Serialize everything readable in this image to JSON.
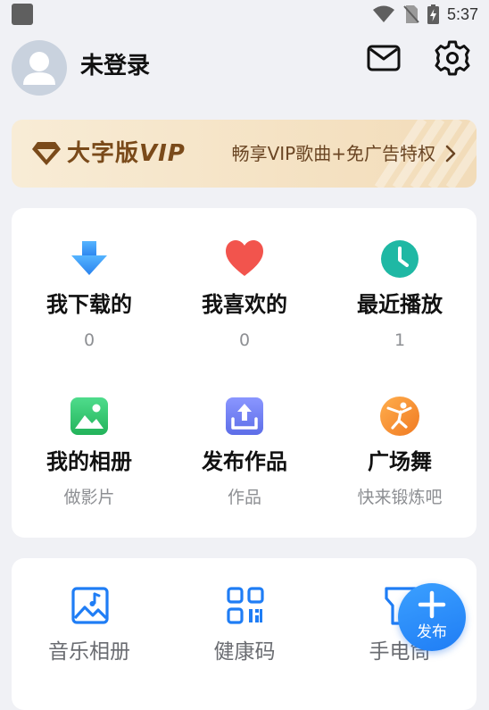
{
  "status_bar": {
    "time": "5:37"
  },
  "header": {
    "login_status": "未登录"
  },
  "vip_banner": {
    "title_cn": "大字版",
    "title_en": "VIP",
    "description": "畅享VIP歌曲+免广告特权"
  },
  "grid": [
    {
      "label": "我下载的",
      "sub": "0",
      "icon": "download-icon",
      "color": "#2f8ff0"
    },
    {
      "label": "我喜欢的",
      "sub": "0",
      "icon": "heart-icon",
      "color": "#f2544d"
    },
    {
      "label": "最近播放",
      "sub": "1",
      "icon": "clock-icon",
      "color": "#1fb8a4"
    },
    {
      "label": "我的相册",
      "sub": "做影片",
      "icon": "photo-album-icon",
      "color": "#35c469"
    },
    {
      "label": "发布作品",
      "sub": "作品",
      "icon": "upload-icon",
      "color": "#6b7cf0"
    },
    {
      "label": "广场舞",
      "sub": "快来锻炼吧",
      "icon": "dancer-icon",
      "color": "#f28a2e"
    }
  ],
  "tools": [
    {
      "label": "音乐相册",
      "icon": "music-album-icon"
    },
    {
      "label": "健康码",
      "icon": "qr-code-icon"
    },
    {
      "label": "手电筒",
      "icon": "flashlight-icon"
    }
  ],
  "fab": {
    "label": "发布"
  },
  "colors": {
    "accent": "#1f7df5",
    "vip_text": "#7a4a1a"
  }
}
